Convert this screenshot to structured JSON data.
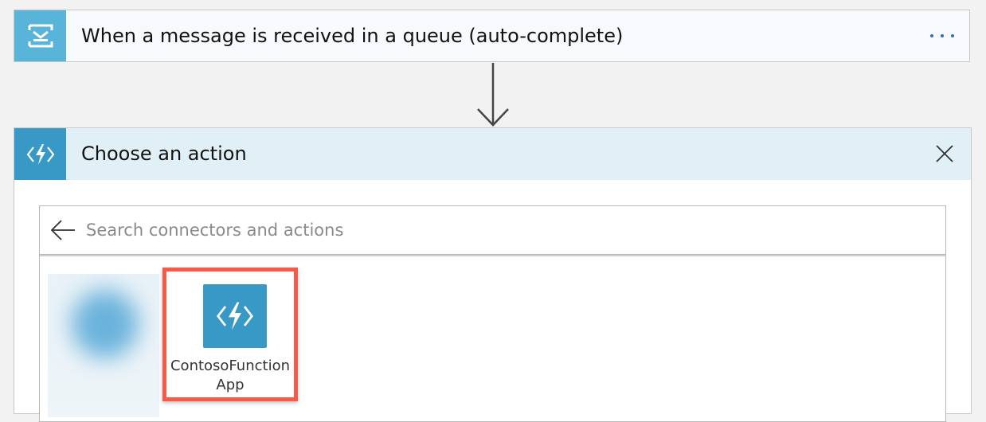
{
  "trigger": {
    "title": "When a message is received in a queue (auto-complete)",
    "icon": "service-bus-icon",
    "more_icon": "ellipsis-icon",
    "icon_bg": "#59b4d9"
  },
  "action_card": {
    "title": "Choose an action",
    "icon": "azure-functions-icon",
    "close_icon": "close-icon",
    "header_bg": "#e1eff7",
    "icon_bg": "#3999c6"
  },
  "search": {
    "placeholder": "Search connectors and actions",
    "value": "",
    "back_icon": "back-arrow-icon"
  },
  "results": {
    "items": [
      {
        "label": "",
        "icon": "blurred-connector-icon"
      },
      {
        "label": "ContosoFunctionApp",
        "icon": "azure-functions-icon",
        "highlighted": true,
        "highlight_color": "#f25c48"
      }
    ]
  }
}
